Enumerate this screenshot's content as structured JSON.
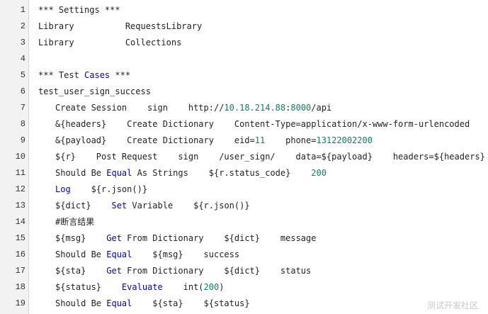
{
  "editor": {
    "line_numbers": [
      "1",
      "2",
      "3",
      "4",
      "5",
      "6",
      "7",
      "8",
      "9",
      "10",
      "11",
      "12",
      "13",
      "14",
      "15",
      "16",
      "17",
      "18",
      "19"
    ],
    "lines": [
      [
        "*** Settings ***"
      ],
      [
        "Library          RequestsLibrary"
      ],
      [
        "Library          Collections"
      ],
      [
        ""
      ],
      [
        "*** Test ",
        "Cases",
        " ***"
      ],
      [
        "test_user_sign_success"
      ],
      [
        "Create Session    sign    http://",
        "10.18.214.88",
        ":",
        "8000",
        "/api"
      ],
      [
        "&{headers}    Create Dictionary    Content-Type=application/x-www-form-urlencoded"
      ],
      [
        "&{payload}    Create Dictionary    eid=",
        "11",
        "    phone=",
        "13122002200"
      ],
      [
        "${r}    Post Request    sign    /user_sign/    data=${payload}    headers=${headers}"
      ],
      [
        "Should Be ",
        "Equal",
        " As Strings    ${r.status_code}    ",
        "200"
      ],
      [
        "Log",
        "    ${r.json()}"
      ],
      [
        "${dict}    ",
        "Set",
        " Variable    ${r.json()}"
      ],
      [
        "#断言结果"
      ],
      [
        "${msg}    ",
        "Get",
        " From Dictionary    ${dict}    message"
      ],
      [
        "Should Be ",
        "Equal",
        "    ${msg}    success"
      ],
      [
        "${sta}    ",
        "Get",
        " From Dictionary    ${dict}    status"
      ],
      [
        "${status}    ",
        "Evaluate",
        "    int(",
        "200",
        ")"
      ],
      [
        "Should Be ",
        "Equal",
        "    ${sta}    ${status}"
      ]
    ]
  },
  "watermark": "测试开发社区",
  "colors": {
    "keyword": "#0000cc",
    "number": "#098658",
    "gutter_bg": "#f2f2f2"
  }
}
